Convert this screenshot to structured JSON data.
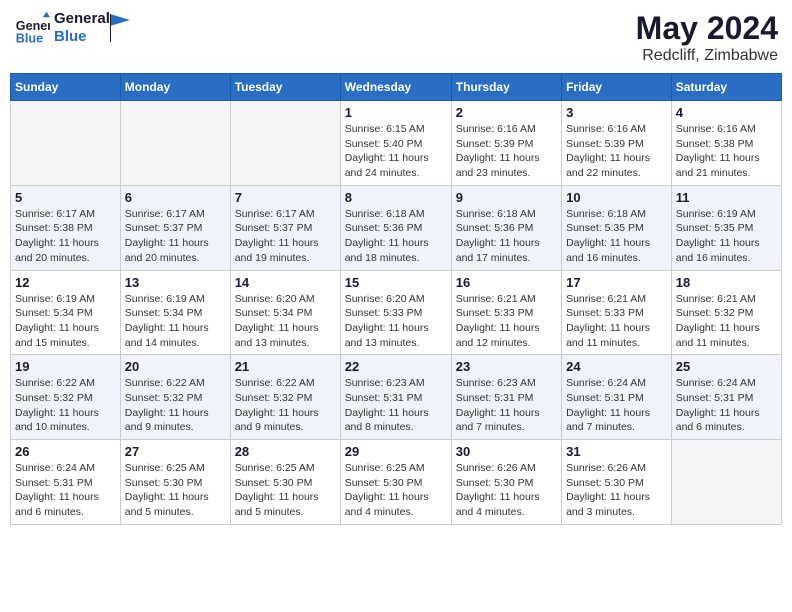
{
  "header": {
    "logo_line1": "General",
    "logo_line2": "Blue",
    "month_title": "May 2024",
    "subtitle": "Redcliff, Zimbabwe"
  },
  "days_of_week": [
    "Sunday",
    "Monday",
    "Tuesday",
    "Wednesday",
    "Thursday",
    "Friday",
    "Saturday"
  ],
  "weeks": [
    [
      {
        "day": "",
        "info": ""
      },
      {
        "day": "",
        "info": ""
      },
      {
        "day": "",
        "info": ""
      },
      {
        "day": "1",
        "info": "Sunrise: 6:15 AM\nSunset: 5:40 PM\nDaylight: 11 hours\nand 24 minutes."
      },
      {
        "day": "2",
        "info": "Sunrise: 6:16 AM\nSunset: 5:39 PM\nDaylight: 11 hours\nand 23 minutes."
      },
      {
        "day": "3",
        "info": "Sunrise: 6:16 AM\nSunset: 5:39 PM\nDaylight: 11 hours\nand 22 minutes."
      },
      {
        "day": "4",
        "info": "Sunrise: 6:16 AM\nSunset: 5:38 PM\nDaylight: 11 hours\nand 21 minutes."
      }
    ],
    [
      {
        "day": "5",
        "info": "Sunrise: 6:17 AM\nSunset: 5:38 PM\nDaylight: 11 hours\nand 20 minutes."
      },
      {
        "day": "6",
        "info": "Sunrise: 6:17 AM\nSunset: 5:37 PM\nDaylight: 11 hours\nand 20 minutes."
      },
      {
        "day": "7",
        "info": "Sunrise: 6:17 AM\nSunset: 5:37 PM\nDaylight: 11 hours\nand 19 minutes."
      },
      {
        "day": "8",
        "info": "Sunrise: 6:18 AM\nSunset: 5:36 PM\nDaylight: 11 hours\nand 18 minutes."
      },
      {
        "day": "9",
        "info": "Sunrise: 6:18 AM\nSunset: 5:36 PM\nDaylight: 11 hours\nand 17 minutes."
      },
      {
        "day": "10",
        "info": "Sunrise: 6:18 AM\nSunset: 5:35 PM\nDaylight: 11 hours\nand 16 minutes."
      },
      {
        "day": "11",
        "info": "Sunrise: 6:19 AM\nSunset: 5:35 PM\nDaylight: 11 hours\nand 16 minutes."
      }
    ],
    [
      {
        "day": "12",
        "info": "Sunrise: 6:19 AM\nSunset: 5:34 PM\nDaylight: 11 hours\nand 15 minutes."
      },
      {
        "day": "13",
        "info": "Sunrise: 6:19 AM\nSunset: 5:34 PM\nDaylight: 11 hours\nand 14 minutes."
      },
      {
        "day": "14",
        "info": "Sunrise: 6:20 AM\nSunset: 5:34 PM\nDaylight: 11 hours\nand 13 minutes."
      },
      {
        "day": "15",
        "info": "Sunrise: 6:20 AM\nSunset: 5:33 PM\nDaylight: 11 hours\nand 13 minutes."
      },
      {
        "day": "16",
        "info": "Sunrise: 6:21 AM\nSunset: 5:33 PM\nDaylight: 11 hours\nand 12 minutes."
      },
      {
        "day": "17",
        "info": "Sunrise: 6:21 AM\nSunset: 5:33 PM\nDaylight: 11 hours\nand 11 minutes."
      },
      {
        "day": "18",
        "info": "Sunrise: 6:21 AM\nSunset: 5:32 PM\nDaylight: 11 hours\nand 11 minutes."
      }
    ],
    [
      {
        "day": "19",
        "info": "Sunrise: 6:22 AM\nSunset: 5:32 PM\nDaylight: 11 hours\nand 10 minutes."
      },
      {
        "day": "20",
        "info": "Sunrise: 6:22 AM\nSunset: 5:32 PM\nDaylight: 11 hours\nand 9 minutes."
      },
      {
        "day": "21",
        "info": "Sunrise: 6:22 AM\nSunset: 5:32 PM\nDaylight: 11 hours\nand 9 minutes."
      },
      {
        "day": "22",
        "info": "Sunrise: 6:23 AM\nSunset: 5:31 PM\nDaylight: 11 hours\nand 8 minutes."
      },
      {
        "day": "23",
        "info": "Sunrise: 6:23 AM\nSunset: 5:31 PM\nDaylight: 11 hours\nand 7 minutes."
      },
      {
        "day": "24",
        "info": "Sunrise: 6:24 AM\nSunset: 5:31 PM\nDaylight: 11 hours\nand 7 minutes."
      },
      {
        "day": "25",
        "info": "Sunrise: 6:24 AM\nSunset: 5:31 PM\nDaylight: 11 hours\nand 6 minutes."
      }
    ],
    [
      {
        "day": "26",
        "info": "Sunrise: 6:24 AM\nSunset: 5:31 PM\nDaylight: 11 hours\nand 6 minutes."
      },
      {
        "day": "27",
        "info": "Sunrise: 6:25 AM\nSunset: 5:30 PM\nDaylight: 11 hours\nand 5 minutes."
      },
      {
        "day": "28",
        "info": "Sunrise: 6:25 AM\nSunset: 5:30 PM\nDaylight: 11 hours\nand 5 minutes."
      },
      {
        "day": "29",
        "info": "Sunrise: 6:25 AM\nSunset: 5:30 PM\nDaylight: 11 hours\nand 4 minutes."
      },
      {
        "day": "30",
        "info": "Sunrise: 6:26 AM\nSunset: 5:30 PM\nDaylight: 11 hours\nand 4 minutes."
      },
      {
        "day": "31",
        "info": "Sunrise: 6:26 AM\nSunset: 5:30 PM\nDaylight: 11 hours\nand 3 minutes."
      },
      {
        "day": "",
        "info": ""
      }
    ]
  ]
}
